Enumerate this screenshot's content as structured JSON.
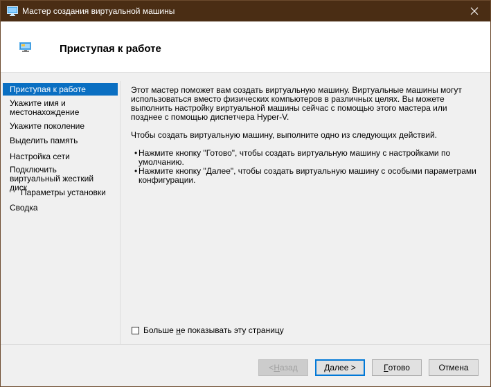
{
  "window": {
    "title": "Мастер создания виртуальной машины",
    "titlebar_color": "#4a2d14"
  },
  "header": {
    "title": "Приступая к работе"
  },
  "sidebar": {
    "items": [
      {
        "label": "Приступая к работе",
        "active": true
      },
      {
        "label": "Укажите имя и местонахождение"
      },
      {
        "label": "Укажите поколение"
      },
      {
        "label": "Выделить память"
      },
      {
        "label": "Настройка сети"
      },
      {
        "label": "Подключить виртуальный жесткий диск"
      },
      {
        "label": "Параметры установки",
        "indent": true
      },
      {
        "label": "Сводка"
      }
    ],
    "active_color": "#0a6fc2"
  },
  "content": {
    "paragraph1": "Этот мастер поможет вам создать виртуальную машину. Виртуальные машины могут использоваться вместо физических компьютеров в различных целях. Вы можете выполнить настройку виртуальной машины сейчас с помощью этого мастера или позднее с помощью диспетчера Hyper-V.",
    "paragraph2": "Чтобы создать виртуальную машину, выполните одно из следующих действий.",
    "bullets": [
      "Нажмите кнопку \"Готово\", чтобы создать виртуальную машину с настройками по умолчанию.",
      "Нажмите кнопку \"Далее\", чтобы создать виртуальную машину с особыми параметрами конфигурации."
    ]
  },
  "checkbox": {
    "label_pre": "Больше ",
    "label_accel": "н",
    "label_post": "е показывать эту страницу",
    "checked": false
  },
  "buttons": {
    "back": {
      "accel": "Н",
      "rest": "азад",
      "prefix": "< "
    },
    "next": {
      "label": "Далее >"
    },
    "finish": {
      "accel": "Г",
      "rest": "отово"
    },
    "cancel": {
      "label": "Отмена"
    }
  },
  "icons": {
    "title": "hyperv-vm-icon",
    "header": "hyperv-vm-icon",
    "close": "close-icon"
  }
}
